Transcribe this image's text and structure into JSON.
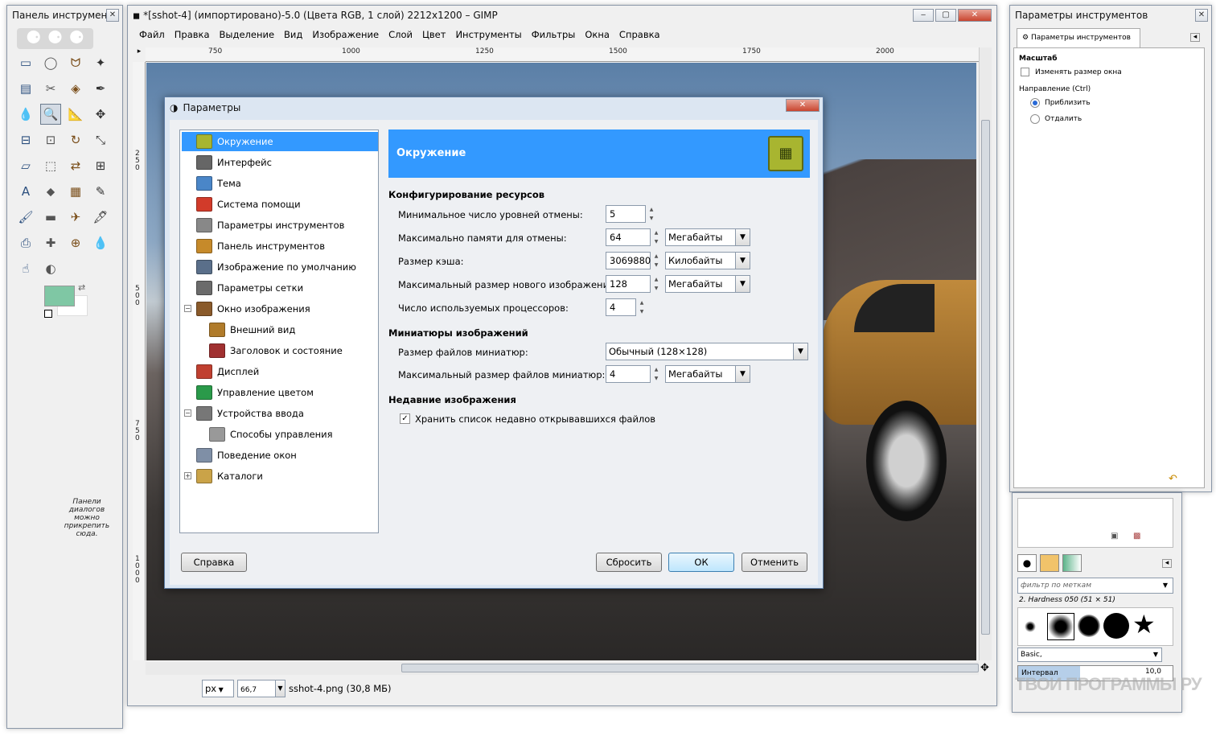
{
  "toolbox": {
    "title": "Панель инструмен",
    "dock_hint": "Панели диалогов можно прикрепить сюда.",
    "fg_color": "#7fc7a4",
    "tools": [
      "rect-select",
      "ellipse-select",
      "free-select",
      "fuzzy-select",
      "color-select",
      "scissors",
      "foreground-select",
      "paths",
      "color-picker",
      "zoom",
      "measure",
      "move",
      "align",
      "crop",
      "rotate",
      "scale",
      "shear",
      "perspective",
      "flip",
      "cage",
      "text",
      "bucket-fill",
      "blend",
      "pencil",
      "paintbrush",
      "eraser",
      "airbrush",
      "ink",
      "clone",
      "heal",
      "perspective-clone",
      "blur",
      "smudge",
      "dodge-burn"
    ]
  },
  "main": {
    "title": "*[sshot-4] (импортировано)-5.0 (Цвета RGB, 1 слой) 2212x1200 – GIMP",
    "menu": [
      "Файл",
      "Правка",
      "Выделение",
      "Вид",
      "Изображение",
      "Слой",
      "Цвет",
      "Инструменты",
      "Фильтры",
      "Окна",
      "Справка"
    ],
    "ruler_ticks": [
      "750",
      "1000",
      "1250",
      "1500",
      "1750",
      "2000"
    ],
    "vruler_ticks": [
      "250",
      "500",
      "750",
      "1000"
    ],
    "status_unit": "px",
    "status_zoom": "66,7",
    "status_file": "sshot-4.png (30,8 МБ)"
  },
  "dialog": {
    "title": "Параметры",
    "tree": [
      {
        "label": "Окружение",
        "icon": "chip-icon",
        "level": 0,
        "selected": true
      },
      {
        "label": "Интерфейс",
        "icon": "gimp-icon",
        "level": 0
      },
      {
        "label": "Тема",
        "icon": "theme-icon",
        "level": 0
      },
      {
        "label": "Система помощи",
        "icon": "lifebuoy-icon",
        "level": 0
      },
      {
        "label": "Параметры инструментов",
        "icon": "tool-options-icon",
        "level": 0
      },
      {
        "label": "Панель инструментов",
        "icon": "toolbox-icon",
        "level": 0
      },
      {
        "label": "Изображение по умолчанию",
        "icon": "default-image-icon",
        "level": 0
      },
      {
        "label": "Параметры сетки",
        "icon": "grid-icon",
        "level": 0
      },
      {
        "label": "Окно изображения",
        "icon": "image-window-icon",
        "level": 0,
        "expander": "−"
      },
      {
        "label": "Внешний вид",
        "icon": "appearance-icon",
        "level": 1
      },
      {
        "label": "Заголовок и состояние",
        "icon": "title-status-icon",
        "level": 1
      },
      {
        "label": "Дисплей",
        "icon": "display-icon",
        "level": 0
      },
      {
        "label": "Управление цветом",
        "icon": "color-management-icon",
        "level": 0
      },
      {
        "label": "Устройства ввода",
        "icon": "input-devices-icon",
        "level": 0,
        "expander": "−"
      },
      {
        "label": "Способы управления",
        "icon": "controllers-icon",
        "level": 1
      },
      {
        "label": "Поведение окон",
        "icon": "window-management-icon",
        "level": 0
      },
      {
        "label": "Каталоги",
        "icon": "folders-icon",
        "level": 0,
        "expander": "+"
      }
    ],
    "banner": "Окружение",
    "sec_resources": "Конфигурирование ресурсов",
    "undo_levels_label": "Минимальное число уровней отмены:",
    "undo_levels": "5",
    "undo_mem_label": "Максимально памяти для отмены:",
    "undo_mem": "64",
    "undo_mem_unit": "Мегабайты",
    "cache_label": "Размер кэша:",
    "cache": "3069880",
    "cache_unit": "Килобайты",
    "new_img_label": "Максимальный размер нового изображения:",
    "new_img": "128",
    "new_img_unit": "Мегабайты",
    "cpu_label": "Число используемых процессоров:",
    "cpu": "4",
    "sec_thumbs": "Миниатюры изображений",
    "thumb_size_label": "Размер файлов миниатюр:",
    "thumb_size": "Обычный (128×128)",
    "thumb_max_label": "Максимальный размер файлов миниатюр:",
    "thumb_max": "4",
    "thumb_max_unit": "Мегабайты",
    "sec_recent": "Недавние изображения",
    "recent_label": "Хранить список недавно открывавшихся файлов",
    "btn_help": "Справка",
    "btn_reset": "Сбросить",
    "btn_ok": "ОК",
    "btn_cancel": "Отменить"
  },
  "tooloptions": {
    "title": "Параметры инструментов",
    "tab": "Параметры инструментов",
    "zoom_head": "Масштаб",
    "resize_label": "Изменять размер окна",
    "direction_label": "Направление (Ctrl)",
    "zoom_in": "Приблизить",
    "zoom_out": "Отдалить"
  },
  "brushes": {
    "filter_placeholder": "фильтр по меткам",
    "brush_name": "2. Hardness 050 (51 × 51)",
    "preset": "Basic,",
    "spacing_label": "Интервал",
    "spacing_value": "10,0"
  },
  "watermark": "ТВОИ ПРОГРАММЫ РУ"
}
